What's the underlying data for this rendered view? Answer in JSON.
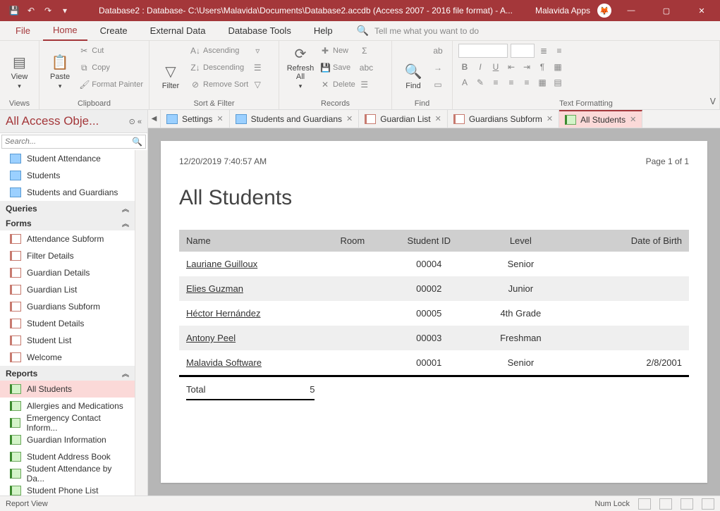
{
  "titlebar": {
    "title": "Database2 : Database- C:\\Users\\Malavida\\Documents\\Database2.accdb (Access 2007 - 2016 file format) - A...",
    "app_label": "Malavida Apps"
  },
  "menu": {
    "file": "File",
    "home": "Home",
    "create": "Create",
    "external": "External Data",
    "dbtools": "Database Tools",
    "help": "Help",
    "search_placeholder": "Tell me what you want to do"
  },
  "ribbon": {
    "views": {
      "label": "Views",
      "view": "View"
    },
    "clipboard": {
      "label": "Clipboard",
      "paste": "Paste",
      "cut": "Cut",
      "copy": "Copy",
      "format_painter": "Format Painter"
    },
    "sortfilter": {
      "label": "Sort & Filter",
      "filter": "Filter",
      "asc": "Ascending",
      "desc": "Descending",
      "remove": "Remove Sort"
    },
    "records": {
      "label": "Records",
      "refresh": "Refresh All",
      "new": "New",
      "save": "Save",
      "delete": "Delete"
    },
    "find": {
      "label": "Find",
      "find": "Find"
    },
    "textfmt": {
      "label": "Text Formatting"
    }
  },
  "nav": {
    "header": "All Access Obje...",
    "search_placeholder": "Search...",
    "tables": [
      "Student Attendance",
      "Students",
      "Students and Guardians"
    ],
    "queries_label": "Queries",
    "forms_label": "Forms",
    "forms": [
      "Attendance Subform",
      "Filter Details",
      "Guardian Details",
      "Guardian List",
      "Guardians Subform",
      "Student Details",
      "Student List",
      "Welcome"
    ],
    "reports_label": "Reports",
    "reports": [
      "All Students",
      "Allergies and Medications",
      "Emergency Contact Inform...",
      "Guardian Information",
      "Student Address Book",
      "Student Attendance by Da...",
      "Student Phone List"
    ]
  },
  "doctabs": [
    {
      "label": "Settings",
      "type": "table"
    },
    {
      "label": "Students and Guardians",
      "type": "table"
    },
    {
      "label": "Guardian List",
      "type": "form"
    },
    {
      "label": "Guardians Subform",
      "type": "form"
    },
    {
      "label": "All Students",
      "type": "report",
      "active": true
    }
  ],
  "report": {
    "timestamp": "12/20/2019 7:40:57 AM",
    "page_info": "Page 1 of 1",
    "title": "All Students",
    "columns": [
      "Name",
      "Room",
      "Student ID",
      "Level",
      "Date of Birth"
    ],
    "rows": [
      {
        "name": "Lauriane Guilloux",
        "room": "",
        "sid": "00004",
        "level": "Senior",
        "dob": ""
      },
      {
        "name": "Elies Guzman",
        "room": "",
        "sid": "00002",
        "level": "Junior",
        "dob": ""
      },
      {
        "name": "Héctor Hernández",
        "room": "",
        "sid": "00005",
        "level": "4th Grade",
        "dob": ""
      },
      {
        "name": "Antony Peel",
        "room": "",
        "sid": "00003",
        "level": "Freshman",
        "dob": ""
      },
      {
        "name": "Malavida Software",
        "room": "",
        "sid": "00001",
        "level": "Senior",
        "dob": "2/8/2001"
      }
    ],
    "total_label": "Total",
    "total_value": "5"
  },
  "status": {
    "left": "Report View",
    "numlock": "Num Lock"
  }
}
